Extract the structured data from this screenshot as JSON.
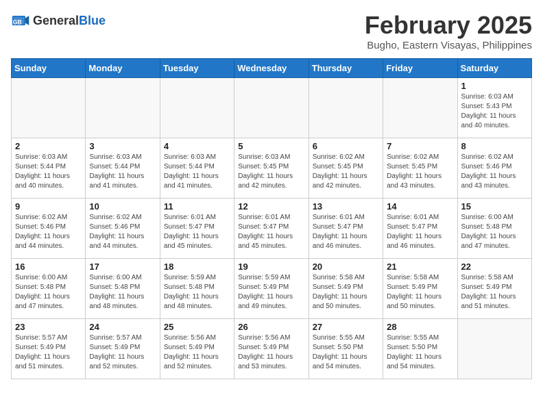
{
  "header": {
    "logo_general": "General",
    "logo_blue": "Blue",
    "month": "February 2025",
    "location": "Bugho, Eastern Visayas, Philippines"
  },
  "days_of_week": [
    "Sunday",
    "Monday",
    "Tuesday",
    "Wednesday",
    "Thursday",
    "Friday",
    "Saturday"
  ],
  "weeks": [
    [
      {
        "day": "",
        "info": ""
      },
      {
        "day": "",
        "info": ""
      },
      {
        "day": "",
        "info": ""
      },
      {
        "day": "",
        "info": ""
      },
      {
        "day": "",
        "info": ""
      },
      {
        "day": "",
        "info": ""
      },
      {
        "day": "1",
        "info": "Sunrise: 6:03 AM\nSunset: 5:43 PM\nDaylight: 11 hours\nand 40 minutes."
      }
    ],
    [
      {
        "day": "2",
        "info": "Sunrise: 6:03 AM\nSunset: 5:44 PM\nDaylight: 11 hours\nand 40 minutes."
      },
      {
        "day": "3",
        "info": "Sunrise: 6:03 AM\nSunset: 5:44 PM\nDaylight: 11 hours\nand 41 minutes."
      },
      {
        "day": "4",
        "info": "Sunrise: 6:03 AM\nSunset: 5:44 PM\nDaylight: 11 hours\nand 41 minutes."
      },
      {
        "day": "5",
        "info": "Sunrise: 6:03 AM\nSunset: 5:45 PM\nDaylight: 11 hours\nand 42 minutes."
      },
      {
        "day": "6",
        "info": "Sunrise: 6:02 AM\nSunset: 5:45 PM\nDaylight: 11 hours\nand 42 minutes."
      },
      {
        "day": "7",
        "info": "Sunrise: 6:02 AM\nSunset: 5:45 PM\nDaylight: 11 hours\nand 43 minutes."
      },
      {
        "day": "8",
        "info": "Sunrise: 6:02 AM\nSunset: 5:46 PM\nDaylight: 11 hours\nand 43 minutes."
      }
    ],
    [
      {
        "day": "9",
        "info": "Sunrise: 6:02 AM\nSunset: 5:46 PM\nDaylight: 11 hours\nand 44 minutes."
      },
      {
        "day": "10",
        "info": "Sunrise: 6:02 AM\nSunset: 5:46 PM\nDaylight: 11 hours\nand 44 minutes."
      },
      {
        "day": "11",
        "info": "Sunrise: 6:01 AM\nSunset: 5:47 PM\nDaylight: 11 hours\nand 45 minutes."
      },
      {
        "day": "12",
        "info": "Sunrise: 6:01 AM\nSunset: 5:47 PM\nDaylight: 11 hours\nand 45 minutes."
      },
      {
        "day": "13",
        "info": "Sunrise: 6:01 AM\nSunset: 5:47 PM\nDaylight: 11 hours\nand 46 minutes."
      },
      {
        "day": "14",
        "info": "Sunrise: 6:01 AM\nSunset: 5:47 PM\nDaylight: 11 hours\nand 46 minutes."
      },
      {
        "day": "15",
        "info": "Sunrise: 6:00 AM\nSunset: 5:48 PM\nDaylight: 11 hours\nand 47 minutes."
      }
    ],
    [
      {
        "day": "16",
        "info": "Sunrise: 6:00 AM\nSunset: 5:48 PM\nDaylight: 11 hours\nand 47 minutes."
      },
      {
        "day": "17",
        "info": "Sunrise: 6:00 AM\nSunset: 5:48 PM\nDaylight: 11 hours\nand 48 minutes."
      },
      {
        "day": "18",
        "info": "Sunrise: 5:59 AM\nSunset: 5:48 PM\nDaylight: 11 hours\nand 48 minutes."
      },
      {
        "day": "19",
        "info": "Sunrise: 5:59 AM\nSunset: 5:49 PM\nDaylight: 11 hours\nand 49 minutes."
      },
      {
        "day": "20",
        "info": "Sunrise: 5:58 AM\nSunset: 5:49 PM\nDaylight: 11 hours\nand 50 minutes."
      },
      {
        "day": "21",
        "info": "Sunrise: 5:58 AM\nSunset: 5:49 PM\nDaylight: 11 hours\nand 50 minutes."
      },
      {
        "day": "22",
        "info": "Sunrise: 5:58 AM\nSunset: 5:49 PM\nDaylight: 11 hours\nand 51 minutes."
      }
    ],
    [
      {
        "day": "23",
        "info": "Sunrise: 5:57 AM\nSunset: 5:49 PM\nDaylight: 11 hours\nand 51 minutes."
      },
      {
        "day": "24",
        "info": "Sunrise: 5:57 AM\nSunset: 5:49 PM\nDaylight: 11 hours\nand 52 minutes."
      },
      {
        "day": "25",
        "info": "Sunrise: 5:56 AM\nSunset: 5:49 PM\nDaylight: 11 hours\nand 52 minutes."
      },
      {
        "day": "26",
        "info": "Sunrise: 5:56 AM\nSunset: 5:49 PM\nDaylight: 11 hours\nand 53 minutes."
      },
      {
        "day": "27",
        "info": "Sunrise: 5:55 AM\nSunset: 5:50 PM\nDaylight: 11 hours\nand 54 minutes."
      },
      {
        "day": "28",
        "info": "Sunrise: 5:55 AM\nSunset: 5:50 PM\nDaylight: 11 hours\nand 54 minutes."
      },
      {
        "day": "",
        "info": ""
      }
    ]
  ]
}
